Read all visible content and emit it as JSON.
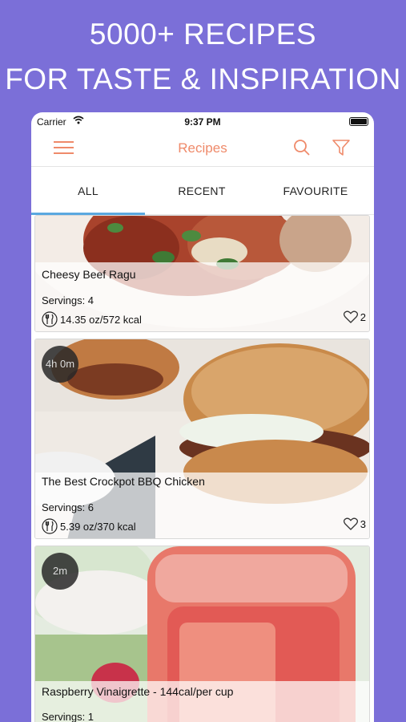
{
  "headline": {
    "line1": "5000+ RECIPES",
    "line2": "FOR TASTE & INSPIRATION"
  },
  "status_bar": {
    "carrier": "Carrier",
    "time": "9:37 PM"
  },
  "nav": {
    "title": "Recipes",
    "icons": [
      "menu-icon",
      "search-icon",
      "filter-icon"
    ]
  },
  "tabs": [
    {
      "label": "ALL",
      "selected": true
    },
    {
      "label": "RECENT",
      "selected": false
    },
    {
      "label": "FAVOURITE",
      "selected": false
    }
  ],
  "recipes": [
    {
      "name": "Cheesy Beef Ragu",
      "servings": "Servings: 4",
      "nutrition": "14.35 oz/572 kcal",
      "likes": "2",
      "time": ""
    },
    {
      "name": "The Best Crockpot BBQ Chicken",
      "servings": "Servings: 6",
      "nutrition": "5.39 oz/370 kcal",
      "likes": "3",
      "time": "4h 0m"
    },
    {
      "name": "Raspberry Vinaigrette - 144cal/per cup",
      "servings": "Servings: 1",
      "nutrition": "",
      "likes": "",
      "time": "2m"
    }
  ],
  "colors": {
    "background": "#7b6fd8",
    "accent": "#ef8a6a",
    "tab_indicator": "#5aa8e0"
  }
}
